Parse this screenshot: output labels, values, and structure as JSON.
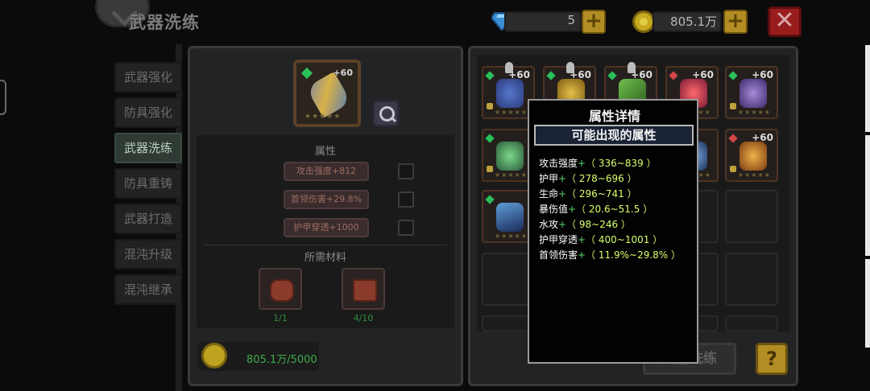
{
  "header": {
    "title": "武器洗练"
  },
  "currency": {
    "gems": "5",
    "gold": "805.1万"
  },
  "side_menu": [
    {
      "label": "武器强化",
      "active": false
    },
    {
      "label": "防具强化",
      "active": false
    },
    {
      "label": "武器洗练",
      "active": true
    },
    {
      "label": "防具重铸",
      "active": false
    },
    {
      "label": "武器打造",
      "active": false
    },
    {
      "label": "混沌升级",
      "active": false
    },
    {
      "label": "混沌继承",
      "active": false
    }
  ],
  "weapon": {
    "level": "+60",
    "stars": "★★★★★"
  },
  "attributes": {
    "label": "属性",
    "items": [
      "攻击强度+812",
      "首领伤害+29.8%",
      "护甲穿透+1000"
    ]
  },
  "materials": {
    "label": "所需材料",
    "items": [
      {
        "count": "1/1"
      },
      {
        "count": "4/10"
      }
    ]
  },
  "gold_cost": "805.1万/5000",
  "grid": {
    "plus_label": "+60",
    "stars": "★★★★★"
  },
  "wash_button": "武器洗练",
  "help_button": "?",
  "popup": {
    "title": "属性详情",
    "subtitle": "可能出现的属性",
    "plus": "+",
    "props": [
      {
        "name": "攻击强度",
        "range": "（ 336~839 ）"
      },
      {
        "name": "护甲",
        "range": "（ 278~696 ）"
      },
      {
        "name": "生命",
        "range": "（ 296~741 ）"
      },
      {
        "name": "暴伤值",
        "range": "（ 20.6~51.5 ）"
      },
      {
        "name": "水攻",
        "range": "（ 98~246 ）"
      },
      {
        "name": "护甲穿透",
        "range": "（ 400~1001 ）"
      },
      {
        "name": "首领伤害",
        "range": "（ 11.9%~29.8% ）"
      }
    ]
  },
  "colors": {
    "accent_gold": "#b28d24",
    "close_red": "#9a1d1d",
    "range_yellow": "#d8ff6a",
    "plus_green": "#55d86b"
  }
}
